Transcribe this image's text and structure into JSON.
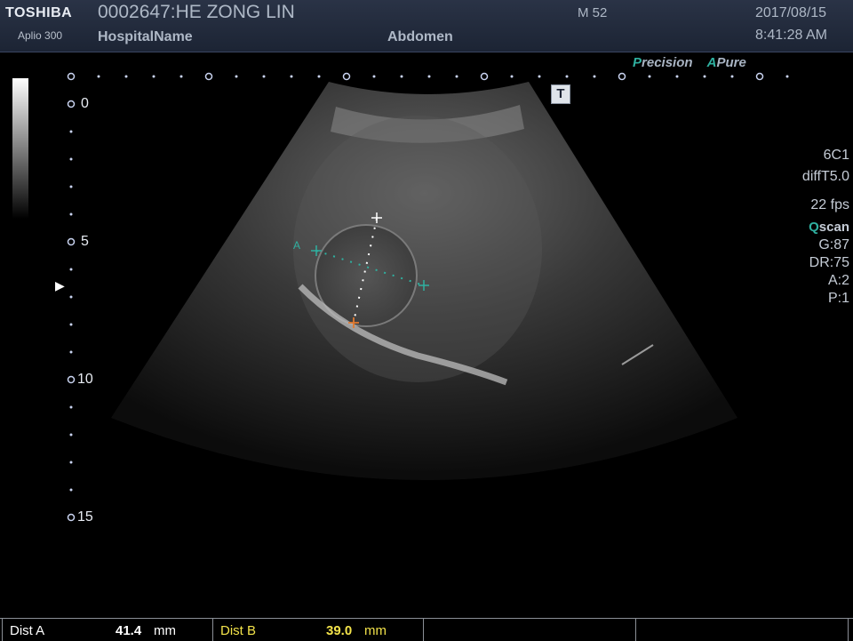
{
  "header": {
    "brand": "TOSHIBA",
    "model": "Aplio 300",
    "patient": "0002647:HE ZONG LIN",
    "hospital": "HospitalName",
    "mi": "M 52",
    "preset": "Abdomen",
    "date": "2017/08/15",
    "time": "8:41:28 AM"
  },
  "modes": {
    "precision_accent": "P",
    "precision_rest": "recision",
    "apure_accent": "A",
    "apure_rest": "Pure"
  },
  "t_marker": "T",
  "params": {
    "probe": "6C1",
    "freq": "diffT5.0",
    "fps": "22 fps",
    "qscan_accent": "Q",
    "qscan_rest": "scan",
    "gain": "G:87",
    "dr": "DR:75",
    "a": "A:2",
    "p": "P:1"
  },
  "depth_labels": {
    "d0": "0",
    "d5": "5",
    "d10": "10",
    "d15": "15"
  },
  "focus_marker": "▶",
  "measure_marker_a": "A",
  "measurements": [
    {
      "label": "Dist  A",
      "value": "41.4",
      "unit": "mm"
    },
    {
      "label": "Dist  B",
      "value": "39.0",
      "unit": "mm"
    }
  ],
  "colors": {
    "accent": "#2fb0a0",
    "measure_a": "#ffffff",
    "measure_b": "#f2e24a",
    "caliper_b": "#e07a30"
  }
}
